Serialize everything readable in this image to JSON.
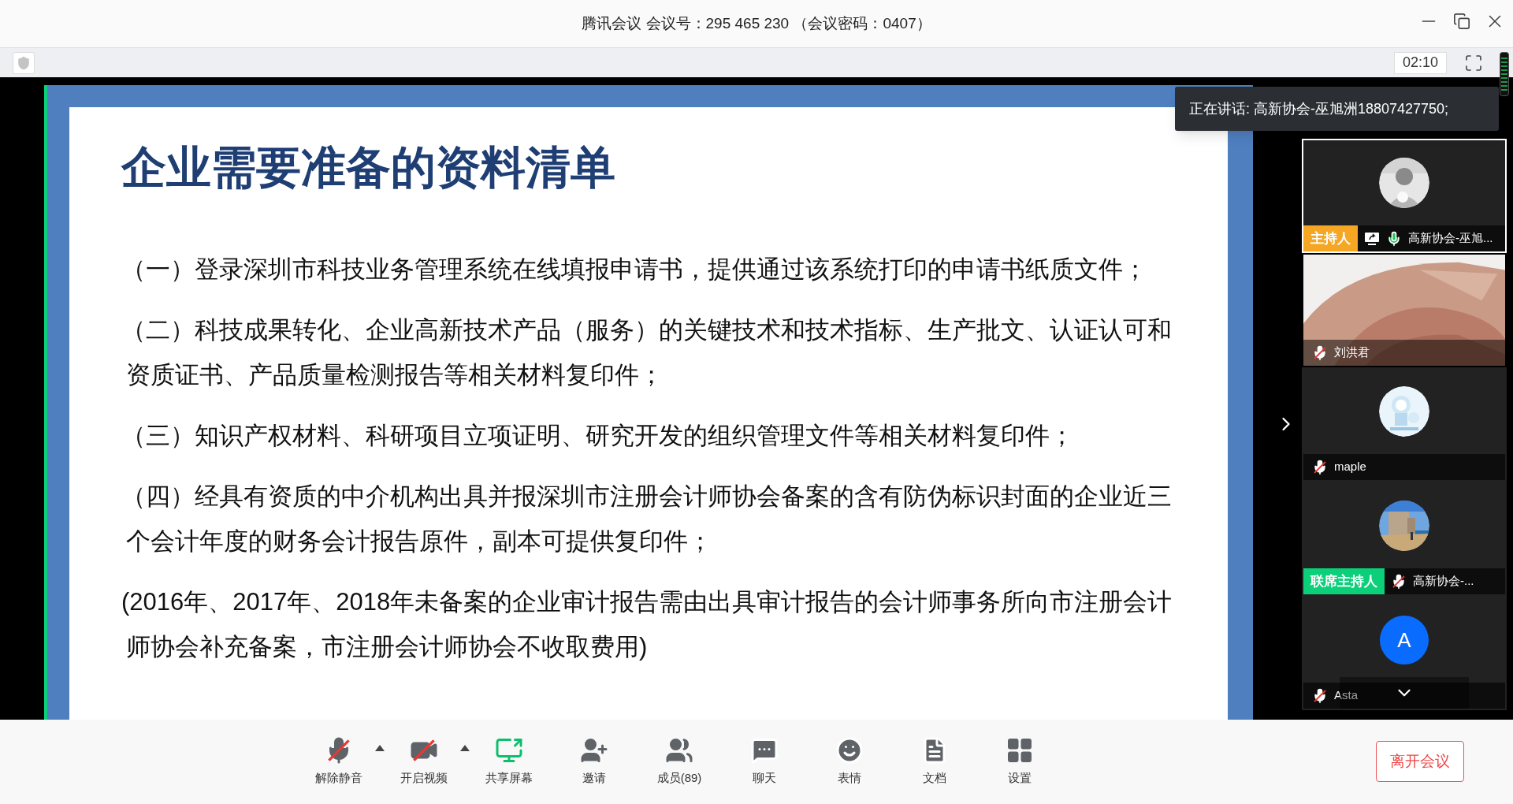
{
  "window": {
    "title": "腾讯会议 会议号：295 465 230 （会议密码：0407）"
  },
  "timer": "02:10",
  "slide": {
    "title": "企业需要准备的资料清单",
    "paragraphs": [
      "（一）登录深圳市科技业务管理系统在线填报申请书，提供通过该系统打印的申请书纸质文件；",
      "（二）科技成果转化、企业高新技术产品（服务）的关键技术和技术指标、生产批文、认证认可和资质证书、产品质量检测报告等相关材料复印件；",
      "（三）知识产权材料、科研项目立项证明、研究开发的组织管理文件等相关材料复印件；",
      "（四）经具有资质的中介机构出具并报深圳市注册会计师协会备案的含有防伪标识封面的企业近三个会计年度的财务会计报告原件，副本可提供复印件；",
      "(2016年、2017年、2018年未备案的企业审计报告需由出具审计报告的会计师事务所向市注册会计师协会补充备案，市注册会计师协会不收取费用)"
    ]
  },
  "speaking": "正在讲话: 高新协会-巫旭洲18807427750;",
  "participants": [
    {
      "kind": "person",
      "name": "高新协会-巫旭...",
      "badge": {
        "text": "主持人",
        "color": "#f5a623"
      },
      "sharing": true,
      "muted": false,
      "selected": true
    },
    {
      "kind": "video",
      "name": "刘洪君",
      "sharing": false,
      "muted": true,
      "selected": false
    },
    {
      "kind": "drawing",
      "name": "maple",
      "sharing": false,
      "muted": true,
      "selected": false
    },
    {
      "kind": "landscape",
      "name": "高新协会-...",
      "badge": {
        "text": "联席主持人",
        "color": "#0ccf7a"
      },
      "sharing": false,
      "muted": true,
      "selected": false
    },
    {
      "kind": "letter",
      "letter": "A",
      "color": "#0a6cff",
      "name": "Asta",
      "sharing": false,
      "muted": true,
      "selected": false
    }
  ],
  "toolbar": [
    {
      "kind": "mic",
      "label": "解除静音",
      "off": true,
      "menu": true
    },
    {
      "kind": "video",
      "label": "开启视频",
      "off": true,
      "menu": true
    },
    {
      "kind": "share",
      "label": "共享屏幕",
      "off": false,
      "menu": false
    },
    {
      "kind": "invite",
      "label": "邀请",
      "off": false,
      "menu": false
    },
    {
      "kind": "members",
      "label": "成员(89)",
      "off": false,
      "menu": false
    },
    {
      "kind": "chat",
      "label": "聊天",
      "off": false,
      "menu": false
    },
    {
      "kind": "emoji",
      "label": "表情",
      "off": false,
      "menu": false
    },
    {
      "kind": "document",
      "label": "文档",
      "off": false,
      "menu": false
    },
    {
      "kind": "settings",
      "label": "设置",
      "off": false,
      "menu": false
    }
  ],
  "leave_button": "离开会议"
}
